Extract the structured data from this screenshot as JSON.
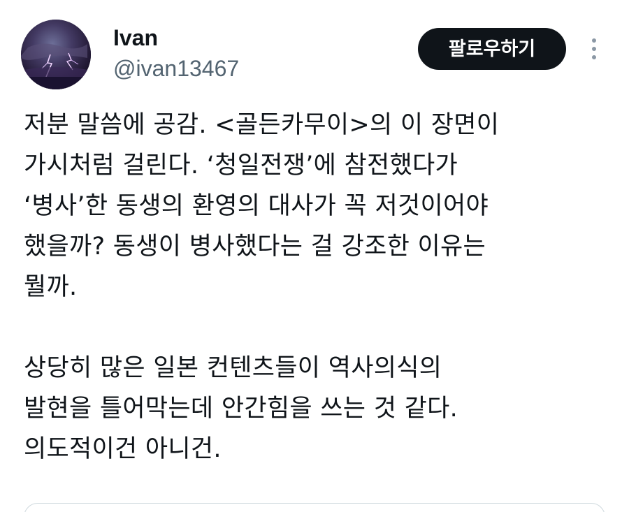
{
  "user": {
    "display_name": "Ivan",
    "handle": "@ivan13467",
    "avatar": "lightning-storm-avatar"
  },
  "actions": {
    "follow_label": "팔로우하기",
    "more_icon": "more-vertical-icon"
  },
  "tweet": {
    "paragraphs": [
      {
        "lines": [
          "저분 말씀에 공감. <골든카무이>의 이 장면이",
          "가시처럼 걸린다. ‘청일전쟁’에 참전했다가",
          "‘병사’한 동생의 환영의 대사가 꼭 저것이어야",
          "했을까? 동생이 병사했다는 걸 강조한 이유는",
          "뭘까."
        ]
      },
      {
        "lines": [
          "상당히 많은 일본 컨텐츠들이 역사의식의",
          "발현을 틀어막는데 안간힘을 쓰는 것 같다.",
          "의도적이건 아니건."
        ]
      }
    ]
  },
  "colors": {
    "text": "#0f1419",
    "secondary": "#536471",
    "button_bg": "#0f1419",
    "button_text": "#ffffff",
    "border": "#cfd9de"
  }
}
